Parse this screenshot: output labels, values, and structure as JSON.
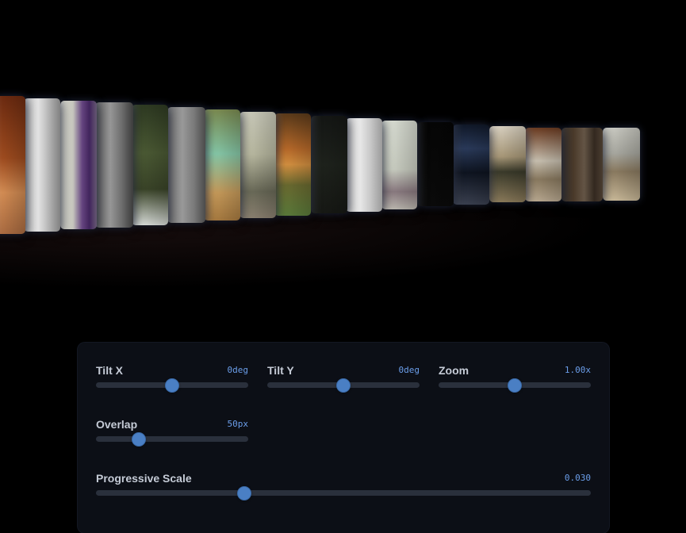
{
  "controls": {
    "tilt_x": {
      "label": "Tilt X",
      "value": "0deg",
      "position": 0.5
    },
    "tilt_y": {
      "label": "Tilt Y",
      "value": "0deg",
      "position": 0.5
    },
    "zoom": {
      "label": "Zoom",
      "value": "1.00x",
      "position": 0.5
    },
    "overlap": {
      "label": "Overlap",
      "value": "50px",
      "position": 0.28
    },
    "progressive_scale": {
      "label": "Progressive Scale",
      "value": "0.030",
      "position": 0.3
    }
  },
  "colors": {
    "background": "#000000",
    "panel": "#0c0f16",
    "accent": "#4a7fc4",
    "value_text": "#6b9eea"
  }
}
